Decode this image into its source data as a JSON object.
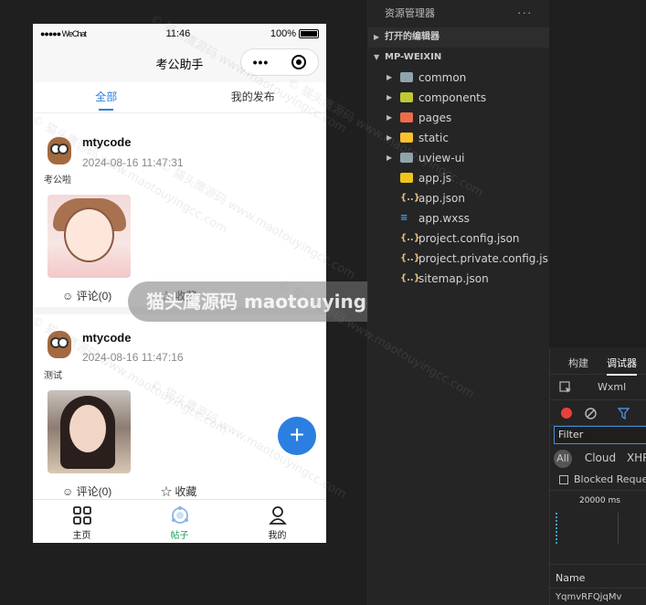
{
  "status_bar": {
    "signal": "●●●●● WeChat",
    "time": "11:46",
    "battery": "100%"
  },
  "navbar": {
    "title": "考公助手"
  },
  "tabs": [
    {
      "label": "全部",
      "active": true
    },
    {
      "label": "我的发布",
      "active": false
    }
  ],
  "posts": [
    {
      "user": "mtycode",
      "time": "2024-08-16 11:47:31",
      "content": "考公啦",
      "comment_label": "评论(0)",
      "favorite_label": "收藏"
    },
    {
      "user": "mtycode",
      "time": "2024-08-16 11:47:16",
      "content": "测试",
      "comment_label": "评论(0)",
      "favorite_label": "收藏"
    }
  ],
  "fab": {
    "label": "+"
  },
  "tabbar": [
    {
      "label": "主页",
      "active": false
    },
    {
      "label": "帖子",
      "active": true
    },
    {
      "label": "我的",
      "active": false
    }
  ],
  "watermark": {
    "toast": "猫头鹰源码 maotouyingcc.com",
    "text": "© 猫头鹰源码 www.maotouyingcc.com"
  },
  "explorer": {
    "title": "资源管理器",
    "more": "···",
    "open_editors": "打开的编辑器",
    "project": "MP-WEIXIN",
    "items": [
      {
        "label": "common",
        "kind": "folder",
        "color": "#90a4ae"
      },
      {
        "label": "components",
        "kind": "folder",
        "color": "#c0ca33"
      },
      {
        "label": "pages",
        "kind": "folder",
        "color": "#ef6c4a"
      },
      {
        "label": "static",
        "kind": "folder",
        "color": "#fbc02d"
      },
      {
        "label": "uview-ui",
        "kind": "folder",
        "color": "#90a4ae"
      },
      {
        "label": "app.js",
        "kind": "js",
        "color": "#f0c419"
      },
      {
        "label": "app.json",
        "kind": "json",
        "color": "#e5c07b"
      },
      {
        "label": "app.wxss",
        "kind": "css",
        "color": "#42a5f5"
      },
      {
        "label": "project.config.json",
        "kind": "json",
        "color": "#e5c07b"
      },
      {
        "label": "project.private.config.js...",
        "kind": "json",
        "color": "#e5c07b"
      },
      {
        "label": "sitemap.json",
        "kind": "json",
        "color": "#e5c07b"
      }
    ]
  },
  "devtools": {
    "tabs": [
      "构建",
      "调试器"
    ],
    "panel": "Wxml",
    "filter_placeholder": "Filter",
    "chips": [
      "All",
      "Cloud",
      "XHR"
    ],
    "blocked": "Blocked Reque",
    "timeline_label": "20000 ms",
    "name_header": "Name",
    "name_row": "YqmvRFQjqMv"
  }
}
